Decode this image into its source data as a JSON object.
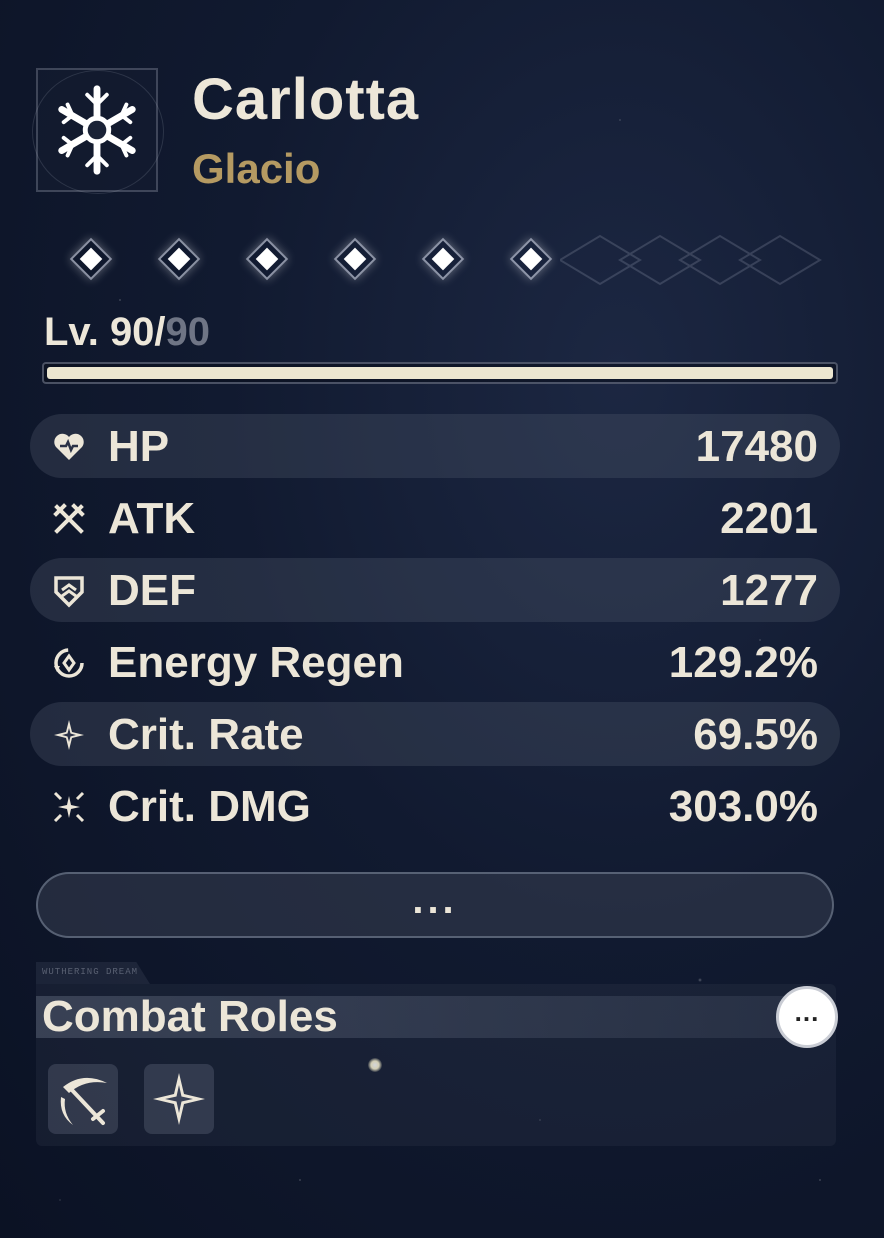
{
  "character": {
    "name": "Carlotta",
    "element": "Glacio",
    "element_icon": "snowflake-icon",
    "resonance_chain": {
      "total": 6,
      "unlocked": 6
    }
  },
  "level": {
    "current": "Lv. 90/",
    "max": "90",
    "progress": 1.0
  },
  "stats": [
    {
      "label": "HP",
      "value": "17480",
      "icon": "heart-icon"
    },
    {
      "label": "ATK",
      "value": "2201",
      "icon": "crossed-swords-icon"
    },
    {
      "label": "DEF",
      "value": "1277",
      "icon": "shield-icon"
    },
    {
      "label": "Energy Regen",
      "value": "129.2%",
      "icon": "energy-regen-icon"
    },
    {
      "label": "Crit. Rate",
      "value": "69.5%",
      "icon": "star-icon"
    },
    {
      "label": "Crit. DMG",
      "value": "303.0%",
      "icon": "burst-icon"
    }
  ],
  "more_button": {
    "label": "..."
  },
  "combat_roles": {
    "title": "Combat Roles",
    "info_label": "...",
    "roles": [
      {
        "icon": "scythe-slash-icon"
      },
      {
        "icon": "four-point-star-icon"
      }
    ]
  },
  "colors": {
    "text": "#ece6d8",
    "element": "#b59a62",
    "level_max": "#6f7585",
    "bar_fill": "#ece6d0"
  }
}
